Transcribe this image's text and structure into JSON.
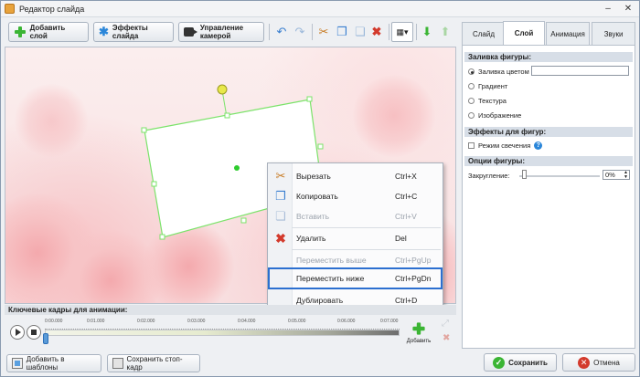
{
  "window": {
    "title": "Редактор слайда"
  },
  "toolbar": {
    "add_layer": "Добавить слой",
    "slide_effects": "Эффекты слайда",
    "camera_control": "Управление камерой"
  },
  "context_menu": {
    "items": [
      {
        "label": "Вырезать",
        "shortcut": "Ctrl+X",
        "icon": "scissors-icon",
        "enabled": true
      },
      {
        "label": "Копировать",
        "shortcut": "Ctrl+C",
        "icon": "copy-icon",
        "enabled": true
      },
      {
        "label": "Вставить",
        "shortcut": "Ctrl+V",
        "icon": "paste-icon",
        "enabled": false
      },
      {
        "label": "Удалить",
        "shortcut": "Del",
        "icon": "delete-icon",
        "enabled": true
      },
      {
        "label": "Переместить выше",
        "shortcut": "Ctrl+PgUp",
        "enabled": false
      },
      {
        "label": "Переместить ниже",
        "shortcut": "Ctrl+PgDn",
        "enabled": true,
        "highlighted": true
      },
      {
        "label": "Дублировать",
        "shortcut": "Ctrl+D",
        "enabled": true
      }
    ]
  },
  "keyframes": {
    "title": "Ключевые кадры для анимации:",
    "ticks": [
      "0:00.000",
      "0:01.000",
      "0:02.000",
      "0:03.000",
      "0:04.000",
      "0:05.000",
      "0:06.000",
      "0:07.000"
    ],
    "add_label": "Добавить"
  },
  "bottom": {
    "add_to_templates": "Добавить в шаблоны",
    "save_frame": "Сохранить стоп-кадр",
    "save": "Сохранить",
    "cancel": "Отмена"
  },
  "panel": {
    "tabs": [
      "Слайд",
      "Слой",
      "Анимация",
      "Звуки"
    ],
    "active_tab": "Слой",
    "fill_section": "Заливка фигуры:",
    "fill_options": [
      "Заливка цветом",
      "Градиент",
      "Текстура",
      "Изображение"
    ],
    "fill_selected": "Заливка цветом",
    "effects_section": "Эффекты для фигур:",
    "glow_label": "Режим свечения",
    "options_section": "Опции фигуры:",
    "rounding_label": "Закругление:",
    "rounding_value": "0%"
  },
  "colors": {
    "accent": "#2c6fd0",
    "selection": "#7be36a",
    "save_green": "#3bb534",
    "cancel_red": "#d33a2c"
  }
}
